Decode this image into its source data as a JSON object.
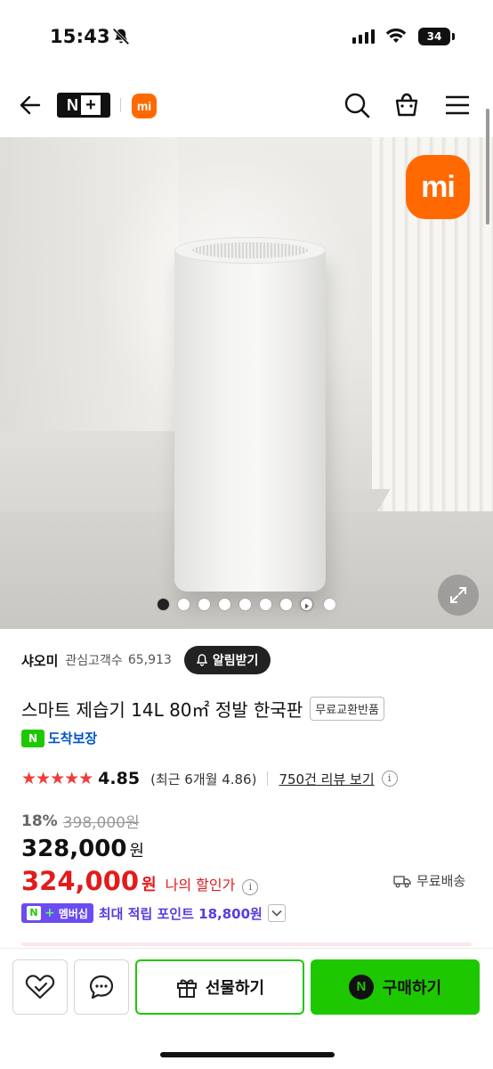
{
  "status": {
    "time": "15:43",
    "battery": "34"
  },
  "header": {
    "logo_text": "N",
    "brand_badge": "mi"
  },
  "hero": {
    "brand_logo": "mi",
    "slide_count": 9,
    "active_slide": 1
  },
  "store": {
    "name": "샤오미",
    "followers_label": "관심고객수",
    "followers": "65,913",
    "alarm_label": "알림받기"
  },
  "product": {
    "title": "스마트 제습기 14L 80㎡ 정발 한국판",
    "badge": "무료교환반품",
    "arrival": "도착보장",
    "arrival_n": "N"
  },
  "rating": {
    "stars": "★★★★★",
    "score": "4.85",
    "recent": "(최근 6개월 4.86)",
    "reviews": "750건 리뷰 보기",
    "info": "i"
  },
  "price": {
    "discount_pct": "18%",
    "original": "398,000원",
    "sale": "328,000",
    "unit": "원",
    "my_price": "324,000",
    "my_label": "나의 할인가",
    "shipping": "무료배송"
  },
  "points": {
    "badge_n": "N",
    "badge_plus": "+",
    "badge_label": "멤버십",
    "text": "최대 적립 포인트 18,800원"
  },
  "bottom": {
    "gift_label": "선물하기",
    "buy_label": "구매하기",
    "buy_n": "N"
  },
  "colors": {
    "naver_green": "#1ec800",
    "xiaomi_orange": "#ff6900",
    "price_red": "#e21b1b",
    "membership_purple": "#6a4cf0"
  }
}
